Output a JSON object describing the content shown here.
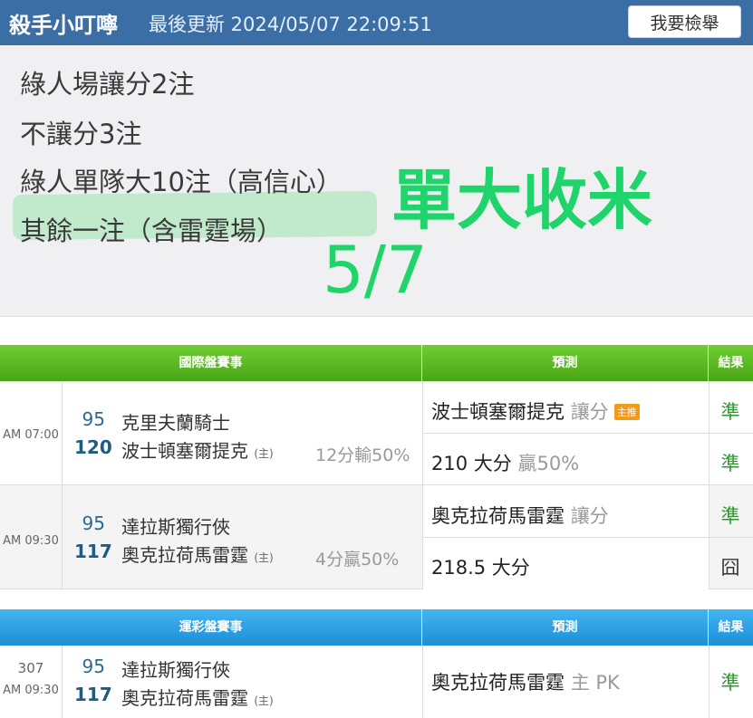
{
  "header": {
    "title": "殺手小叮嚀",
    "updated": "最後更新 2024/05/07 22:09:51",
    "report_label": "我要檢舉"
  },
  "note": {
    "lines": [
      "綠人場讓分2注",
      "不讓分3注",
      "綠人單隊大10注（高信心）",
      "其餘一注（含雷霆場）"
    ],
    "stamp_text": "單大收米",
    "stamp_date": "5/7"
  },
  "international": {
    "headers": [
      "國際盤賽事",
      "預測",
      "結果"
    ],
    "games": [
      {
        "time": "AM 07:00",
        "away_score": "95",
        "away_team": "克里夫蘭騎士",
        "home_score": "120",
        "home_team": "波士頓塞爾提克",
        "home_mark": "(主)",
        "spread": "12分輸50%",
        "predictions": [
          {
            "main": "波士頓塞爾提克",
            "sub": "讓分",
            "tag": "主推",
            "result": "準"
          },
          {
            "main": "210 大分",
            "sub": "贏50%",
            "tag": "",
            "result": "準"
          }
        ]
      },
      {
        "time": "AM 09:30",
        "away_score": "95",
        "away_team": "達拉斯獨行俠",
        "home_score": "117",
        "home_team": "奧克拉荷馬雷霆",
        "home_mark": "(主)",
        "spread": "4分贏50%",
        "predictions": [
          {
            "main": "奧克拉荷馬雷霆",
            "sub": "讓分",
            "tag": "",
            "result": "準"
          },
          {
            "main": "218.5 大分",
            "sub": "",
            "tag": "",
            "result": "囧"
          }
        ]
      }
    ]
  },
  "lottery": {
    "headers": [
      "運彩盤賽事",
      "預測",
      "結果"
    ],
    "games": [
      {
        "id": "307",
        "time": "AM 09:30",
        "away_score": "95",
        "away_team": "達拉斯獨行俠",
        "home_score": "117",
        "home_team": "奧克拉荷馬雷霆",
        "home_mark": "(主)",
        "prediction": {
          "main": "奧克拉荷馬雷霆",
          "sub": "主 PK",
          "result": "準"
        }
      }
    ]
  },
  "colors": {
    "header_bg": "#3b6ea5",
    "green_header": "#5bb823",
    "blue_header": "#2aa0e4",
    "stamp_green": "#1fd46a",
    "ok_green": "#2a9a2a",
    "tag_orange": "#f29b1a"
  }
}
